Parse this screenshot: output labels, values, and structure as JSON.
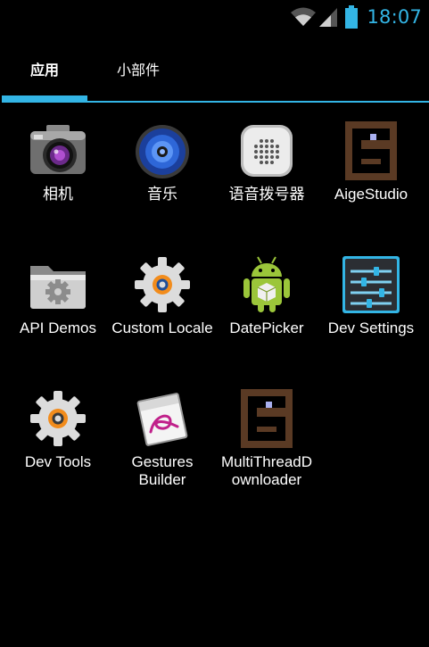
{
  "status_bar": {
    "time": "18:07",
    "accent": "#33b5e5",
    "icons": [
      "wifi-icon",
      "signal-icon",
      "battery-icon"
    ]
  },
  "tabs": [
    {
      "label": "应用",
      "selected": true
    },
    {
      "label": "小部件",
      "selected": false
    }
  ],
  "apps": [
    {
      "label": "相机",
      "icon": "camera-icon"
    },
    {
      "label": "音乐",
      "icon": "music-icon"
    },
    {
      "label": "语音拨号器",
      "icon": "voice-dialer-icon"
    },
    {
      "label": "AigeStudio",
      "icon": "aigestudio-icon"
    },
    {
      "label": "API Demos",
      "icon": "folder-gear-icon"
    },
    {
      "label": "Custom Locale",
      "icon": "gear-icon"
    },
    {
      "label": "DatePicker",
      "icon": "android-robot-icon"
    },
    {
      "label": "Dev Settings",
      "icon": "sliders-icon"
    },
    {
      "label": "Dev Tools",
      "icon": "gear-icon"
    },
    {
      "label": "Gestures Builder",
      "icon": "gesture-card-icon"
    },
    {
      "label": "MultiThreadD ownloader",
      "icon": "aigestudio-icon"
    }
  ]
}
